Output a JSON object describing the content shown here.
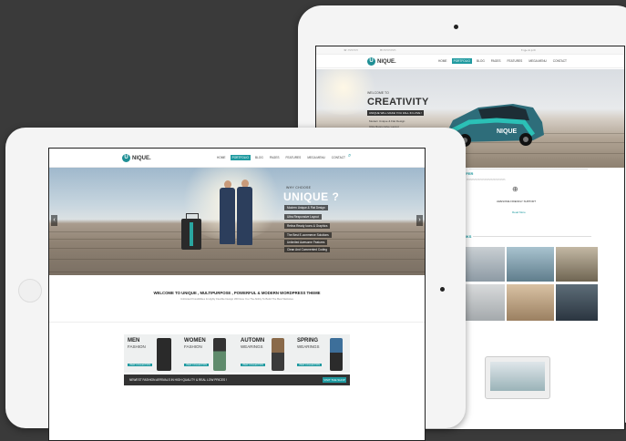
{
  "front": {
    "logo": "NIQUE.",
    "menu": [
      "HOME",
      "PORTFOLIO",
      "BLOG",
      "PAGES",
      "FEATURES",
      "MEGA MENU",
      "CONTACT"
    ],
    "active_menu": "PORTFOLIO",
    "hero": {
      "why": "WHY CHOOSE",
      "title": "UNIQUE ?",
      "features": [
        "Modern Unique & Flat Design",
        "Ultra Responsive Layout",
        "Retina Ready Icons & Graphics",
        "The Best E-commerce Solutions",
        "Unlimited Awesome Features",
        "Clean And Commented Coding"
      ]
    },
    "welcome": {
      "title": "WELCOME TO UNIQUE , MULTIPURPOSE , POWERFUL & MODERN WORDPRESS THEME",
      "subtitle": "Unlimited Possibilities & Highly Flexible Design Will Give You The Ability To Build The Best Websites"
    },
    "collections": [
      {
        "title": "MEN",
        "subtitle": "FASHION",
        "cta": "VIEW COLLECTION"
      },
      {
        "title": "WOMEN",
        "subtitle": "FASHION",
        "cta": "VIEW COLLECTION"
      },
      {
        "title": "AUTOMN",
        "subtitle": "WEARINGS",
        "cta": "VIEW COLLECTION"
      },
      {
        "title": "SPRING",
        "subtitle": "WEARINGS",
        "cta": "VIEW COLLECTION"
      }
    ],
    "promo": {
      "text": "NEWEST FASHION ARRIVALS IN HIGH QUALITY & REAL LOW PRICES !",
      "button": "VISIT THE SHOP"
    }
  },
  "back": {
    "logo": "NIQUE.",
    "menu": [
      "HOME",
      "PORTFOLIO",
      "BLOG",
      "PAGES",
      "FEATURES",
      "MEGA MENU",
      "CONTACT"
    ],
    "active_menu": "PORTFOLIO",
    "hero": {
      "small": "WELCOME TO",
      "title": "CREATIVITY",
      "badge": "UNIQUE WILL MAKE YOU FALL IN LOVE !",
      "bullets": [
        "Modern Unique & Flat Design",
        "Ultra Responsive Layout"
      ]
    },
    "section1": "FFER",
    "section1_item": "AWESOME FRIENDLY SUPPORT",
    "section1_link": "Read More",
    "section2": "RKS"
  },
  "colors": {
    "accent": "#1f9aa0",
    "background": "#3a3a3a",
    "tablet": "#f4f4f4"
  }
}
